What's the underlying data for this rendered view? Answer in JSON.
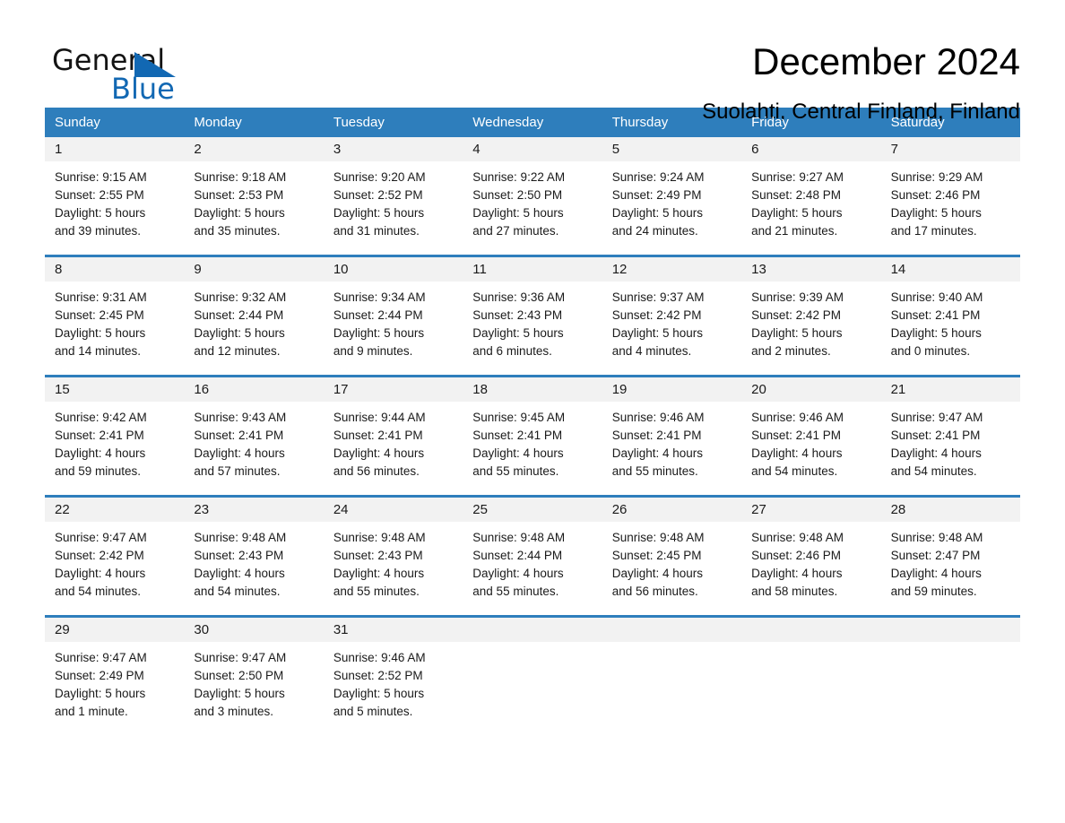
{
  "brand": {
    "word_general": "General",
    "word_blue": "Blue",
    "triangle_color": "#1268b3"
  },
  "header": {
    "title": "December 2024",
    "subtitle": "Suolahti, Central Finland, Finland"
  },
  "theme": {
    "header_blue": "#2e7ebc",
    "daynum_band": "#f2f2f2",
    "text": "#1a1a1a"
  },
  "weekdays": [
    "Sunday",
    "Monday",
    "Tuesday",
    "Wednesday",
    "Thursday",
    "Friday",
    "Saturday"
  ],
  "weeks": [
    {
      "days": [
        {
          "num": "1",
          "sunrise": "Sunrise: 9:15 AM",
          "sunset": "Sunset: 2:55 PM",
          "daylight1": "Daylight: 5 hours",
          "daylight2": "and 39 minutes."
        },
        {
          "num": "2",
          "sunrise": "Sunrise: 9:18 AM",
          "sunset": "Sunset: 2:53 PM",
          "daylight1": "Daylight: 5 hours",
          "daylight2": "and 35 minutes."
        },
        {
          "num": "3",
          "sunrise": "Sunrise: 9:20 AM",
          "sunset": "Sunset: 2:52 PM",
          "daylight1": "Daylight: 5 hours",
          "daylight2": "and 31 minutes."
        },
        {
          "num": "4",
          "sunrise": "Sunrise: 9:22 AM",
          "sunset": "Sunset: 2:50 PM",
          "daylight1": "Daylight: 5 hours",
          "daylight2": "and 27 minutes."
        },
        {
          "num": "5",
          "sunrise": "Sunrise: 9:24 AM",
          "sunset": "Sunset: 2:49 PM",
          "daylight1": "Daylight: 5 hours",
          "daylight2": "and 24 minutes."
        },
        {
          "num": "6",
          "sunrise": "Sunrise: 9:27 AM",
          "sunset": "Sunset: 2:48 PM",
          "daylight1": "Daylight: 5 hours",
          "daylight2": "and 21 minutes."
        },
        {
          "num": "7",
          "sunrise": "Sunrise: 9:29 AM",
          "sunset": "Sunset: 2:46 PM",
          "daylight1": "Daylight: 5 hours",
          "daylight2": "and 17 minutes."
        }
      ]
    },
    {
      "days": [
        {
          "num": "8",
          "sunrise": "Sunrise: 9:31 AM",
          "sunset": "Sunset: 2:45 PM",
          "daylight1": "Daylight: 5 hours",
          "daylight2": "and 14 minutes."
        },
        {
          "num": "9",
          "sunrise": "Sunrise: 9:32 AM",
          "sunset": "Sunset: 2:44 PM",
          "daylight1": "Daylight: 5 hours",
          "daylight2": "and 12 minutes."
        },
        {
          "num": "10",
          "sunrise": "Sunrise: 9:34 AM",
          "sunset": "Sunset: 2:44 PM",
          "daylight1": "Daylight: 5 hours",
          "daylight2": "and 9 minutes."
        },
        {
          "num": "11",
          "sunrise": "Sunrise: 9:36 AM",
          "sunset": "Sunset: 2:43 PM",
          "daylight1": "Daylight: 5 hours",
          "daylight2": "and 6 minutes."
        },
        {
          "num": "12",
          "sunrise": "Sunrise: 9:37 AM",
          "sunset": "Sunset: 2:42 PM",
          "daylight1": "Daylight: 5 hours",
          "daylight2": "and 4 minutes."
        },
        {
          "num": "13",
          "sunrise": "Sunrise: 9:39 AM",
          "sunset": "Sunset: 2:42 PM",
          "daylight1": "Daylight: 5 hours",
          "daylight2": "and 2 minutes."
        },
        {
          "num": "14",
          "sunrise": "Sunrise: 9:40 AM",
          "sunset": "Sunset: 2:41 PM",
          "daylight1": "Daylight: 5 hours",
          "daylight2": "and 0 minutes."
        }
      ]
    },
    {
      "days": [
        {
          "num": "15",
          "sunrise": "Sunrise: 9:42 AM",
          "sunset": "Sunset: 2:41 PM",
          "daylight1": "Daylight: 4 hours",
          "daylight2": "and 59 minutes."
        },
        {
          "num": "16",
          "sunrise": "Sunrise: 9:43 AM",
          "sunset": "Sunset: 2:41 PM",
          "daylight1": "Daylight: 4 hours",
          "daylight2": "and 57 minutes."
        },
        {
          "num": "17",
          "sunrise": "Sunrise: 9:44 AM",
          "sunset": "Sunset: 2:41 PM",
          "daylight1": "Daylight: 4 hours",
          "daylight2": "and 56 minutes."
        },
        {
          "num": "18",
          "sunrise": "Sunrise: 9:45 AM",
          "sunset": "Sunset: 2:41 PM",
          "daylight1": "Daylight: 4 hours",
          "daylight2": "and 55 minutes."
        },
        {
          "num": "19",
          "sunrise": "Sunrise: 9:46 AM",
          "sunset": "Sunset: 2:41 PM",
          "daylight1": "Daylight: 4 hours",
          "daylight2": "and 55 minutes."
        },
        {
          "num": "20",
          "sunrise": "Sunrise: 9:46 AM",
          "sunset": "Sunset: 2:41 PM",
          "daylight1": "Daylight: 4 hours",
          "daylight2": "and 54 minutes."
        },
        {
          "num": "21",
          "sunrise": "Sunrise: 9:47 AM",
          "sunset": "Sunset: 2:41 PM",
          "daylight1": "Daylight: 4 hours",
          "daylight2": "and 54 minutes."
        }
      ]
    },
    {
      "days": [
        {
          "num": "22",
          "sunrise": "Sunrise: 9:47 AM",
          "sunset": "Sunset: 2:42 PM",
          "daylight1": "Daylight: 4 hours",
          "daylight2": "and 54 minutes."
        },
        {
          "num": "23",
          "sunrise": "Sunrise: 9:48 AM",
          "sunset": "Sunset: 2:43 PM",
          "daylight1": "Daylight: 4 hours",
          "daylight2": "and 54 minutes."
        },
        {
          "num": "24",
          "sunrise": "Sunrise: 9:48 AM",
          "sunset": "Sunset: 2:43 PM",
          "daylight1": "Daylight: 4 hours",
          "daylight2": "and 55 minutes."
        },
        {
          "num": "25",
          "sunrise": "Sunrise: 9:48 AM",
          "sunset": "Sunset: 2:44 PM",
          "daylight1": "Daylight: 4 hours",
          "daylight2": "and 55 minutes."
        },
        {
          "num": "26",
          "sunrise": "Sunrise: 9:48 AM",
          "sunset": "Sunset: 2:45 PM",
          "daylight1": "Daylight: 4 hours",
          "daylight2": "and 56 minutes."
        },
        {
          "num": "27",
          "sunrise": "Sunrise: 9:48 AM",
          "sunset": "Sunset: 2:46 PM",
          "daylight1": "Daylight: 4 hours",
          "daylight2": "and 58 minutes."
        },
        {
          "num": "28",
          "sunrise": "Sunrise: 9:48 AM",
          "sunset": "Sunset: 2:47 PM",
          "daylight1": "Daylight: 4 hours",
          "daylight2": "and 59 minutes."
        }
      ]
    },
    {
      "days": [
        {
          "num": "29",
          "sunrise": "Sunrise: 9:47 AM",
          "sunset": "Sunset: 2:49 PM",
          "daylight1": "Daylight: 5 hours",
          "daylight2": "and 1 minute."
        },
        {
          "num": "30",
          "sunrise": "Sunrise: 9:47 AM",
          "sunset": "Sunset: 2:50 PM",
          "daylight1": "Daylight: 5 hours",
          "daylight2": "and 3 minutes."
        },
        {
          "num": "31",
          "sunrise": "Sunrise: 9:46 AM",
          "sunset": "Sunset: 2:52 PM",
          "daylight1": "Daylight: 5 hours",
          "daylight2": "and 5 minutes."
        },
        {
          "num": "",
          "sunrise": "",
          "sunset": "",
          "daylight1": "",
          "daylight2": ""
        },
        {
          "num": "",
          "sunrise": "",
          "sunset": "",
          "daylight1": "",
          "daylight2": ""
        },
        {
          "num": "",
          "sunrise": "",
          "sunset": "",
          "daylight1": "",
          "daylight2": ""
        },
        {
          "num": "",
          "sunrise": "",
          "sunset": "",
          "daylight1": "",
          "daylight2": ""
        }
      ]
    }
  ]
}
